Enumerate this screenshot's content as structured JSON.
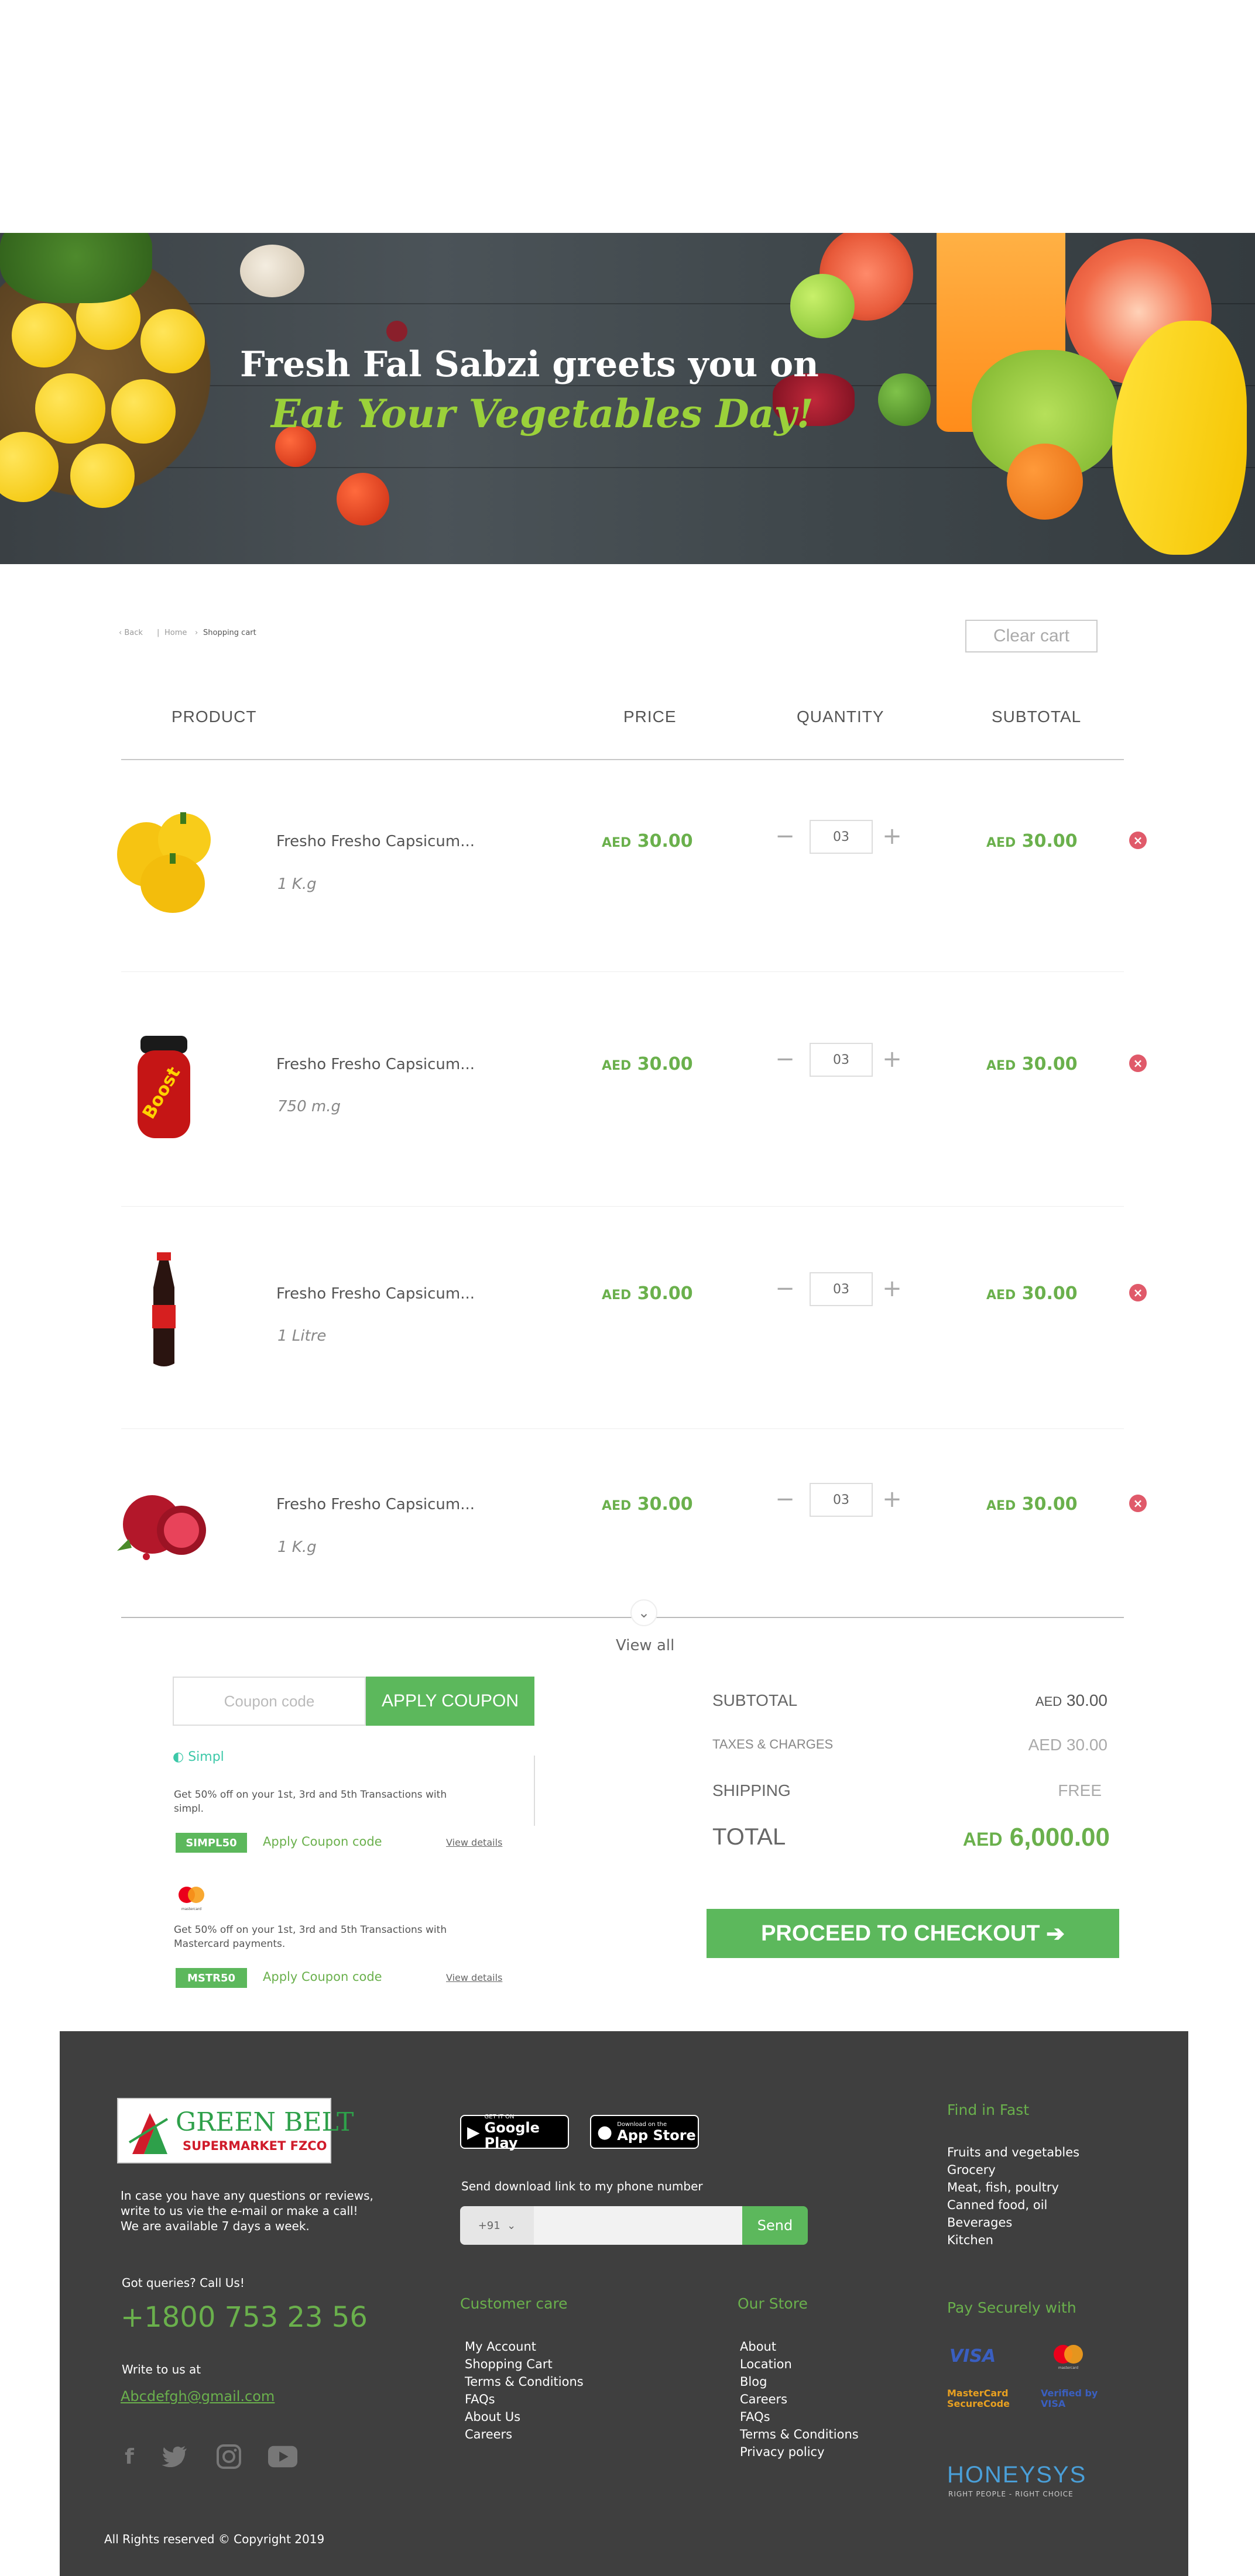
{
  "banner": {
    "line1": "Fresh Fal Sabzi greets you on",
    "line2": "Eat Your Vegetables Day!"
  },
  "breadcrumb": {
    "back": "Back",
    "home": "Home",
    "current": "Shopping cart"
  },
  "clear_cart": "Clear cart",
  "table_headers": {
    "product": "PRODUCT",
    "price": "PRICE",
    "quantity": "QUANTITY",
    "subtotal": "SUBTOTAL"
  },
  "cart_items": [
    {
      "name": "Fresho Fresho Capsicum...",
      "size": "1 K.g",
      "currency": "AED",
      "price": "30.00",
      "qty": "03",
      "subtotal": "30.00",
      "image": "yellow-capsicum"
    },
    {
      "name": "Fresho Fresho Capsicum...",
      "size": "750 m.g",
      "currency": "AED",
      "price": "30.00",
      "qty": "03",
      "subtotal": "30.00",
      "image": "boost-jar"
    },
    {
      "name": "Fresho Fresho Capsicum...",
      "size": "1 Litre",
      "currency": "AED",
      "price": "30.00",
      "qty": "03",
      "subtotal": "30.00",
      "image": "coca-cola-bottle"
    },
    {
      "name": "Fresho Fresho Capsicum...",
      "size": "1 K.g",
      "currency": "AED",
      "price": "30.00",
      "qty": "03",
      "subtotal": "30.00",
      "image": "pomegranate"
    }
  ],
  "view_all": "View all",
  "coupon": {
    "placeholder": "Coupon code",
    "apply_label": "APPLY COUPON",
    "offers": [
      {
        "brand": "Simpl",
        "text": "Get 50% off on your 1st, 3rd and 5th Transactions with simpl.",
        "code": "SIMPL50",
        "apply": "Apply Coupon code",
        "view": "View details"
      },
      {
        "brand": "mastercard",
        "text": "Get 50% off on your 1st, 3rd and 5th Transactions with Mastercard payments.",
        "code": "MSTR50",
        "apply": "Apply Coupon code",
        "view": "View details"
      }
    ]
  },
  "summary": {
    "subtotal_label": "SUBTOTAL",
    "subtotal_currency": "AED",
    "subtotal_value": "30.00",
    "taxes_label": "TAXES & CHARGES",
    "taxes_value": "AED 30.00",
    "shipping_label": "SHIPPING",
    "shipping_value": "FREE",
    "total_label": "TOTAL",
    "total_currency": "AED",
    "total_value": "6,000.00",
    "checkout_label": "PROCEED TO CHECKOUT"
  },
  "footer": {
    "logo_name": "GREEN BELT",
    "logo_sub": "SUPERMARKET FZCO",
    "contact_text": [
      "In case you have any questions or reviews,",
      "write to us vie the e-mail or make a call!",
      "We are available 7 days a week."
    ],
    "queries_label": "Got queries? Call Us!",
    "phone": "+1800 753 23 56",
    "write_label": "Write to us at",
    "email": "Abcdefgh@gmail.com",
    "google_play_small": "GET IT ON",
    "google_play_big": "Google Play",
    "app_store_small": "Download on the",
    "app_store_big": "App Store",
    "send_link_label": "Send download link to my phone number",
    "country_code": "+91",
    "send_button": "Send",
    "customer_care_title": "Customer care",
    "customer_care_links": [
      "My Account",
      "Shopping Cart",
      "Terms & Conditions",
      "FAQs",
      "About Us",
      "Careers"
    ],
    "our_store_title": "Our Store",
    "our_store_links": [
      "About",
      "Location",
      "Blog",
      "Careers",
      "FAQs",
      "Terms & Conditions",
      "Privacy policy"
    ],
    "find_fast_title": "Find in Fast",
    "find_fast_links": [
      "Fruits and vegetables",
      "Grocery",
      "Meat, fish, poultry",
      "Canned food, oil",
      "Beverages",
      "Kitchen"
    ],
    "pay_title": "Pay Securely with",
    "pay_logos": [
      "VISA",
      "mastercard",
      "MasterCard SecureCode",
      "Verified by VISA"
    ],
    "partner_name": "HONEYSYS",
    "partner_tagline": "RIGHT PEOPLE - RIGHT CHOICE",
    "copyright": "All Rights reserved © Copyright 2019"
  },
  "colors": {
    "accent": "#5cb85c",
    "price_green": "#6ab04c",
    "footer_bg": "#3f3f3f",
    "remove_red": "#e05a6a"
  }
}
